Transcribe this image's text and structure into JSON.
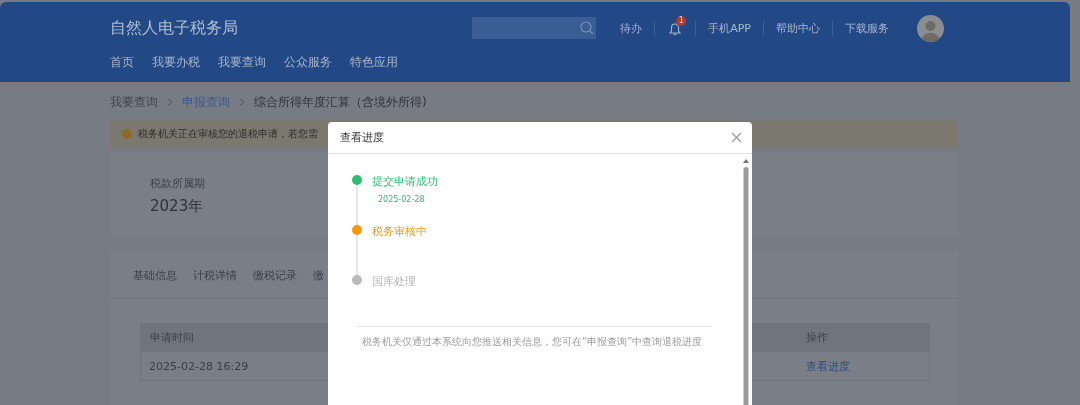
{
  "header": {
    "title": "自然人电子税务局",
    "nav": [
      {
        "label": "首页"
      },
      {
        "label": "我要办税"
      },
      {
        "label": "我要查询"
      },
      {
        "label": "公众服务"
      },
      {
        "label": "特色应用"
      }
    ],
    "actions": [
      {
        "kind": "link",
        "label": "待办"
      },
      {
        "kind": "bell",
        "badge": "1"
      },
      {
        "kind": "link",
        "label": "手机APP"
      },
      {
        "kind": "link",
        "label": "帮助中心"
      },
      {
        "kind": "link",
        "label": "下载服务"
      }
    ]
  },
  "breadcrumb": [
    {
      "kind": "muted",
      "label": "我要查询"
    },
    {
      "kind": "link",
      "label": "申报查询"
    },
    {
      "kind": "current",
      "label": "综合所得年度汇算（含境外所得)"
    }
  ],
  "notice": {
    "text": "税务机关正在审核您的退税申请，若您需"
  },
  "period": {
    "label": "税款所属期",
    "value": "2023年"
  },
  "tabs": [
    {
      "label": "基础信息"
    },
    {
      "label": "计税详情"
    },
    {
      "label": "缴税记录"
    },
    {
      "label": "缴"
    }
  ],
  "table": {
    "columns": [
      {
        "label": "申请时间"
      },
      {
        "label": "操作"
      }
    ],
    "rows": [
      {
        "time": "2025-02-28 16:29",
        "action": "查看进度"
      }
    ]
  },
  "dialog": {
    "title": "查看进度",
    "steps": [
      {
        "completed": true,
        "active": false,
        "label": "提交申请成功",
        "date": "2025-02-28"
      },
      {
        "completed": false,
        "active": true,
        "label": "税务审核中"
      },
      {
        "completed": false,
        "active": false,
        "label": "国库处理"
      }
    ],
    "note": "税务机关仅通过本系统向您推送相关信息，您可在“申报查询”中查询退税进度"
  }
}
